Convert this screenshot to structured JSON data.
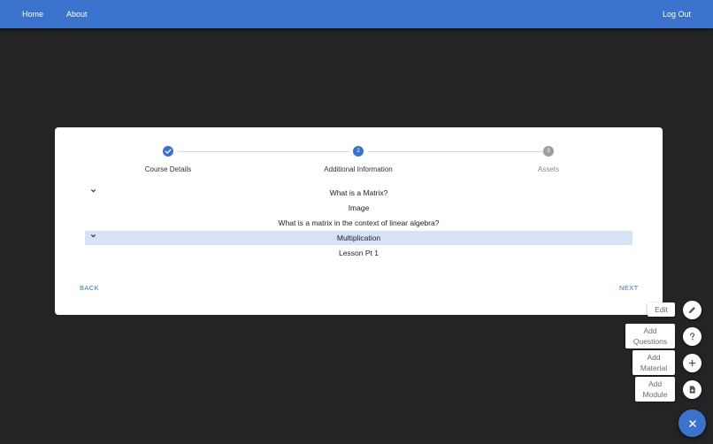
{
  "nav": {
    "home": "Home",
    "about": "About",
    "logout": "Log Out"
  },
  "stepper": {
    "steps": [
      {
        "label": "Course Details",
        "state": "completed",
        "number": ""
      },
      {
        "label": "Additional Information",
        "state": "active",
        "number": "2"
      },
      {
        "label": "Assets",
        "state": "inactive",
        "number": "3"
      }
    ]
  },
  "tree": {
    "rows": [
      {
        "text": "What is a Matrix?",
        "expandable": true,
        "highlighted": false
      },
      {
        "text": "Image",
        "expandable": false,
        "highlighted": false
      },
      {
        "text": "What is a matrix in the context of linear algebra?",
        "expandable": false,
        "highlighted": false
      },
      {
        "text": "Multiplication",
        "expandable": true,
        "highlighted": true
      },
      {
        "text": "Lesson Pt 1",
        "expandable": false,
        "highlighted": false
      }
    ]
  },
  "actions": {
    "back": "BACK",
    "next": "NEXT"
  },
  "speed_dial": {
    "edit": "Edit",
    "add_questions_1": "Add",
    "add_questions_2": "Questions",
    "add_material_1": "Add",
    "add_material_2": "Material",
    "add_module_1": "Add",
    "add_module_2": "Module"
  },
  "colors": {
    "primary": "#3a72cc",
    "background": "#242424",
    "highlight_row": "#d6e2f6",
    "inactive_step": "#9e9e9e"
  },
  "icons": [
    "check-icon",
    "pencil-icon",
    "question-icon",
    "plus-icon",
    "document-icon",
    "close-icon",
    "chevron-down-icon"
  ]
}
